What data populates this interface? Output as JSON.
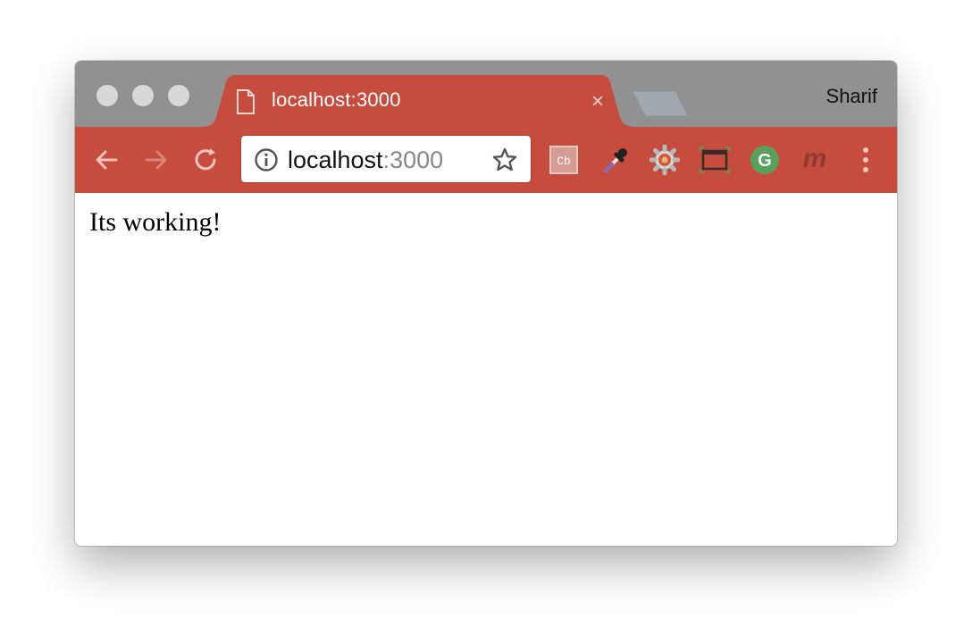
{
  "window": {
    "profile_name": "Sharif"
  },
  "tab": {
    "title": "localhost:3000",
    "close_glyph": "×",
    "icon": "file-icon"
  },
  "toolbar": {
    "url_host": "localhost",
    "url_port": ":3000",
    "buttons": [
      "back-arrow-icon",
      "forward-arrow-icon",
      "reload-icon"
    ],
    "extensions": [
      {
        "name": "cb-extension-icon",
        "label": "Cb"
      },
      {
        "name": "eyedropper-extension-icon"
      },
      {
        "name": "gear-extension-icon"
      },
      {
        "name": "window-resize-extension-icon"
      },
      {
        "name": "grammarly-extension-icon",
        "label": "G"
      },
      {
        "name": "m-extension-icon",
        "label": "m"
      }
    ]
  },
  "page": {
    "body_text": "Its working!"
  },
  "colors": {
    "toolbar": "#c64d3d",
    "titlebar": "#919191",
    "grammarly": "#5aa05d"
  }
}
